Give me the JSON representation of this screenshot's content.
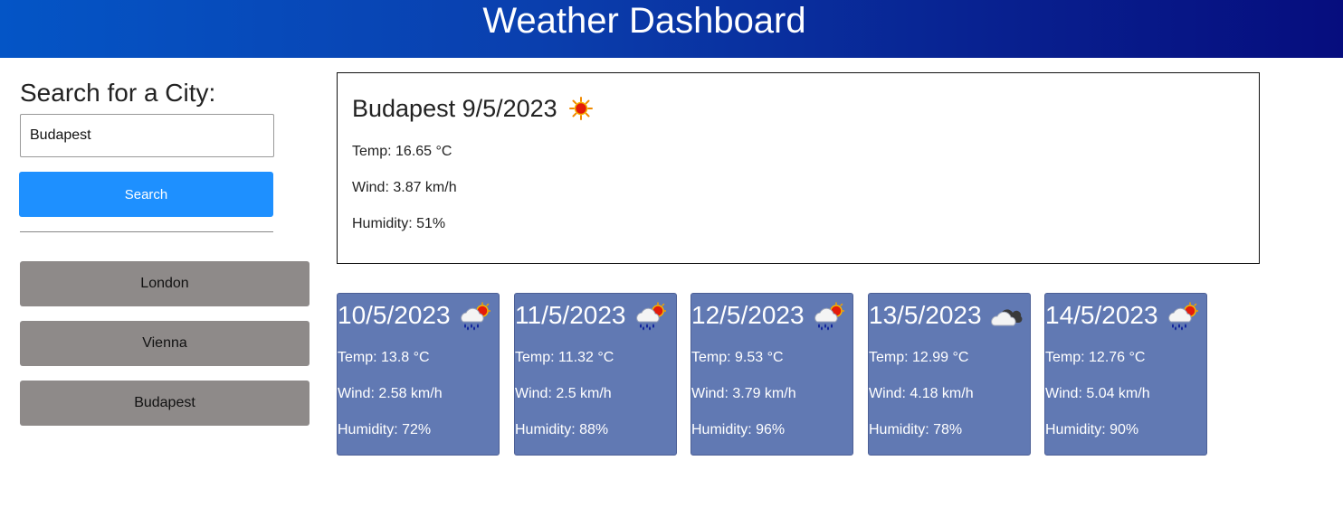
{
  "header": {
    "title": "Weather Dashboard"
  },
  "sidebar": {
    "search_heading": "Search for a City:",
    "search_value": "Budapest",
    "search_button_label": "Search",
    "history": [
      {
        "label": "London"
      },
      {
        "label": "Vienna"
      },
      {
        "label": "Budapest"
      }
    ]
  },
  "current": {
    "title": "Budapest 9/5/2023",
    "icon": "sun-icon",
    "temp": "Temp: 16.65 °C",
    "wind": "Wind: 3.87 km/h",
    "humidity": "Humidity: 51%"
  },
  "forecast": [
    {
      "date": "10/5/2023",
      "icon": "rain-sun-cloud-icon",
      "temp": "Temp: 13.8 °C",
      "wind": "Wind: 2.58 km/h",
      "humidity": "Humidity: 72%"
    },
    {
      "date": "11/5/2023",
      "icon": "rain-sun-cloud-icon",
      "temp": "Temp: 11.32 °C",
      "wind": "Wind: 2.5 km/h",
      "humidity": "Humidity: 88%"
    },
    {
      "date": "12/5/2023",
      "icon": "rain-sun-cloud-icon",
      "temp": "Temp: 9.53 °C",
      "wind": "Wind: 3.79 km/h",
      "humidity": "Humidity: 96%"
    },
    {
      "date": "13/5/2023",
      "icon": "cloud-icon",
      "temp": "Temp: 12.99 °C",
      "wind": "Wind: 4.18 km/h",
      "humidity": "Humidity: 78%"
    },
    {
      "date": "14/5/2023",
      "icon": "rain-sun-cloud-icon",
      "temp": "Temp: 12.76 °C",
      "wind": "Wind: 5.04 km/h",
      "humidity": "Humidity: 90%"
    }
  ],
  "colors": {
    "header_start": "#0455c6",
    "header_end": "#060d7e",
    "search_button": "#1e90ff",
    "history_button": "#8e8a89",
    "forecast_card": "#6179b3"
  }
}
